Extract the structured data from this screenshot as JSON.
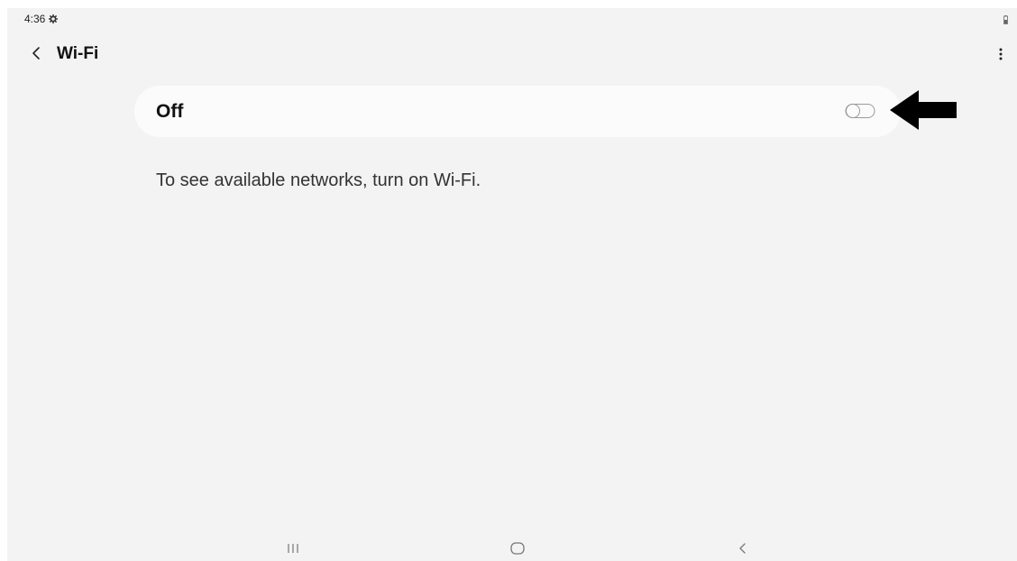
{
  "status_bar": {
    "time": "4:36",
    "settings_icon": "gear-icon",
    "battery_icon": "battery-icon"
  },
  "app_bar": {
    "back_icon": "chevron-left-icon",
    "title": "Wi-Fi",
    "more_icon": "more-vertical-icon"
  },
  "wifi_toggle": {
    "label": "Off",
    "state": "off",
    "annotation": "arrow-left-icon"
  },
  "message": "To see available networks, turn on Wi-Fi.",
  "nav_bar": {
    "recents_icon": "recents-icon",
    "home_icon": "home-icon",
    "back_icon": "back-icon"
  },
  "colors": {
    "background": "#f3f3f3",
    "card": "#fbfbfb",
    "text": "#111111",
    "toggle_outline": "#9a9a9a"
  }
}
